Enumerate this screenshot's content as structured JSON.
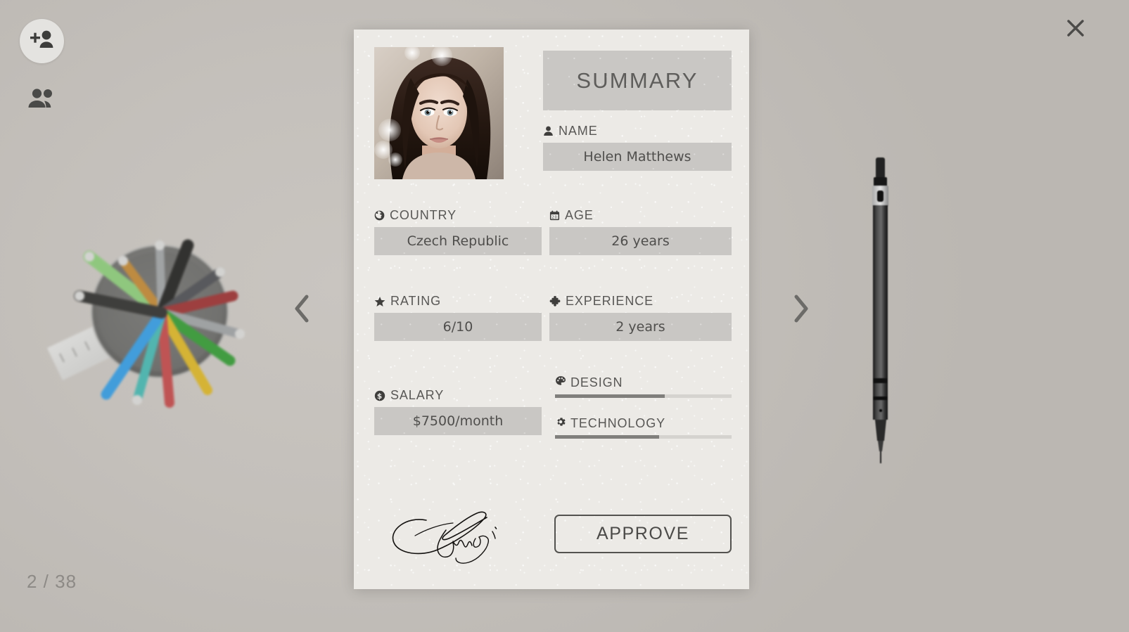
{
  "window": {
    "page_counter": "2 / 38",
    "close_label": "×"
  },
  "toolbar": {
    "add_person_icon": "add-person-icon",
    "people_icon": "people-group-icon"
  },
  "nav": {
    "prev_label": "‹",
    "next_label": "›"
  },
  "card": {
    "banner_title": "SUMMARY",
    "photo_alt": "candidate-portrait",
    "fields": {
      "name": {
        "label": "NAME",
        "value": "Helen Matthews",
        "icon": "person-icon"
      },
      "country": {
        "label": "COUNTRY",
        "value": "Czech Republic",
        "icon": "globe-icon"
      },
      "age": {
        "label": "AGE",
        "value": "26 years",
        "icon": "calendar-icon"
      },
      "rating": {
        "label": "RATING",
        "value": "6/10",
        "icon": "star-icon"
      },
      "experience": {
        "label": "EXPERIENCE",
        "value": "2 years",
        "icon": "puzzle-piece-icon"
      },
      "salary": {
        "label": "SALARY",
        "value": "$7500/month",
        "icon": "dollar-coin-icon"
      }
    },
    "skills": [
      {
        "label": "DESIGN",
        "icon": "palette-icon",
        "percent": 62
      },
      {
        "label": "TECHNOLOGY",
        "icon": "gear-icon",
        "percent": 59
      }
    ],
    "approve_label": "APPROVE",
    "signature_alt": "handwritten-signature"
  },
  "colors": {
    "background": "#c2beb9",
    "card": "#eceae6",
    "chip": "#c9c7c4",
    "text": "#585755",
    "bar_fill": "#807f7c",
    "bar_track": "#d5d3cf",
    "button_border": "#53524f"
  }
}
